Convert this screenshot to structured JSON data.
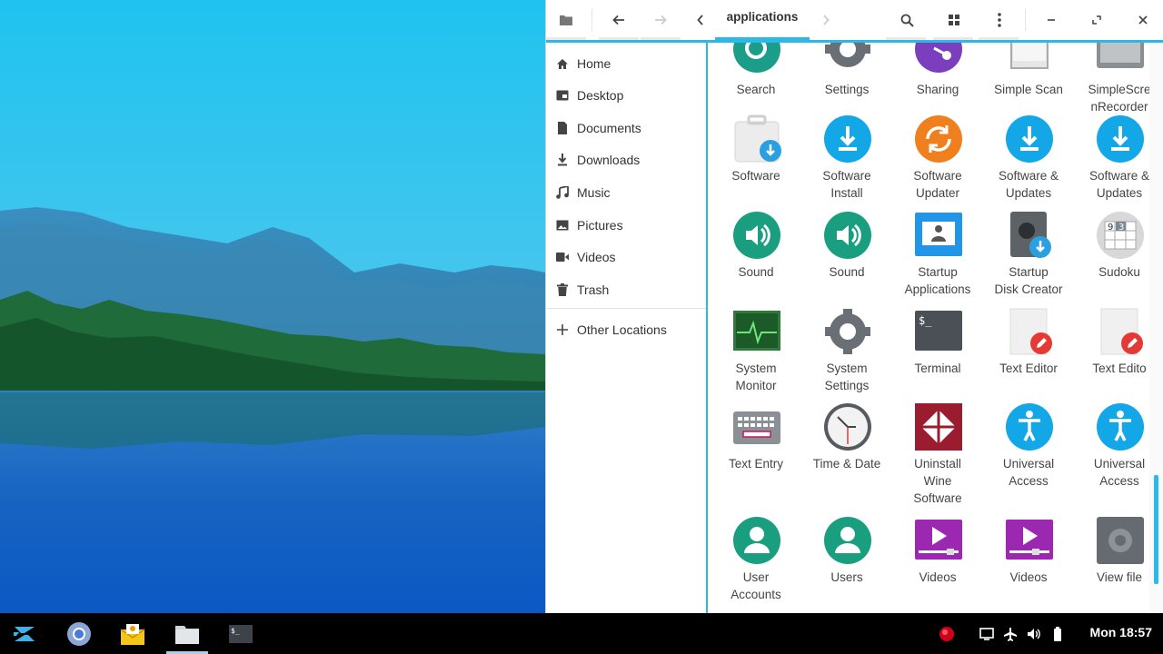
{
  "window": {
    "breadcrumb": "applications"
  },
  "sidebar": {
    "items": [
      {
        "label": "Home",
        "icon": "home-icon"
      },
      {
        "label": "Desktop",
        "icon": "desktop-icon"
      },
      {
        "label": "Documents",
        "icon": "document-icon"
      },
      {
        "label": "Downloads",
        "icon": "download-icon"
      },
      {
        "label": "Music",
        "icon": "music-icon"
      },
      {
        "label": "Pictures",
        "icon": "picture-icon"
      },
      {
        "label": "Videos",
        "icon": "video-icon"
      },
      {
        "label": "Trash",
        "icon": "trash-icon"
      }
    ],
    "other": {
      "label": "Other Locations",
      "icon": "plus-icon"
    }
  },
  "apps": [
    {
      "label": "Search",
      "icon": "search-app-icon"
    },
    {
      "label": "Settings",
      "icon": "settings-app-icon"
    },
    {
      "label": "Sharing",
      "icon": "sharing-app-icon"
    },
    {
      "label": "Simple Scan",
      "icon": "scanner-app-icon"
    },
    {
      "label": "SimpleScre\nnRecorder",
      "icon": "screen-recorder-app-icon"
    },
    {
      "label": "Software",
      "icon": "software-app-icon"
    },
    {
      "label": "Software\nInstall",
      "icon": "software-install-app-icon"
    },
    {
      "label": "Software\nUpdater",
      "icon": "software-updater-app-icon"
    },
    {
      "label": "Software &\nUpdates",
      "icon": "software-updates-app-icon"
    },
    {
      "label": "Software &\nUpdates",
      "icon": "software-updates-app-icon"
    },
    {
      "label": "Sound",
      "icon": "sound-app-icon"
    },
    {
      "label": "Sound",
      "icon": "sound-app-icon"
    },
    {
      "label": "Startup\nApplications",
      "icon": "startup-apps-app-icon"
    },
    {
      "label": "Startup\nDisk Creator",
      "icon": "startup-disk-app-icon"
    },
    {
      "label": "Sudoku",
      "icon": "sudoku-app-icon"
    },
    {
      "label": "System\nMonitor",
      "icon": "system-monitor-app-icon"
    },
    {
      "label": "System\nSettings",
      "icon": "system-settings-app-icon"
    },
    {
      "label": "Terminal",
      "icon": "terminal-app-icon"
    },
    {
      "label": "Text Editor",
      "icon": "text-editor-app-icon"
    },
    {
      "label": "Text Edito",
      "icon": "text-editor-app-icon"
    },
    {
      "label": "Text Entry",
      "icon": "keyboard-app-icon"
    },
    {
      "label": "Time & Date",
      "icon": "clock-app-icon"
    },
    {
      "label": "Uninstall\nWine\nSoftware",
      "icon": "wine-uninstall-app-icon"
    },
    {
      "label": "Universal\nAccess",
      "icon": "accessibility-app-icon"
    },
    {
      "label": "Universal\nAccess",
      "icon": "accessibility-app-icon"
    },
    {
      "label": "User\nAccounts",
      "icon": "user-accounts-app-icon"
    },
    {
      "label": "Users",
      "icon": "users-app-icon"
    },
    {
      "label": "Videos",
      "icon": "videos-app-icon"
    },
    {
      "label": "Videos",
      "icon": "videos-app-icon"
    },
    {
      "label": "View file",
      "icon": "view-file-app-icon"
    }
  ],
  "taskbar": {
    "apps": [
      "zorin-menu-icon",
      "chromium-icon",
      "mail-icon",
      "files-icon",
      "terminal-icon"
    ],
    "clock": "Mon 18:57"
  },
  "colors": {
    "accent": "#2cb9e8",
    "taskbar": "#000000"
  }
}
